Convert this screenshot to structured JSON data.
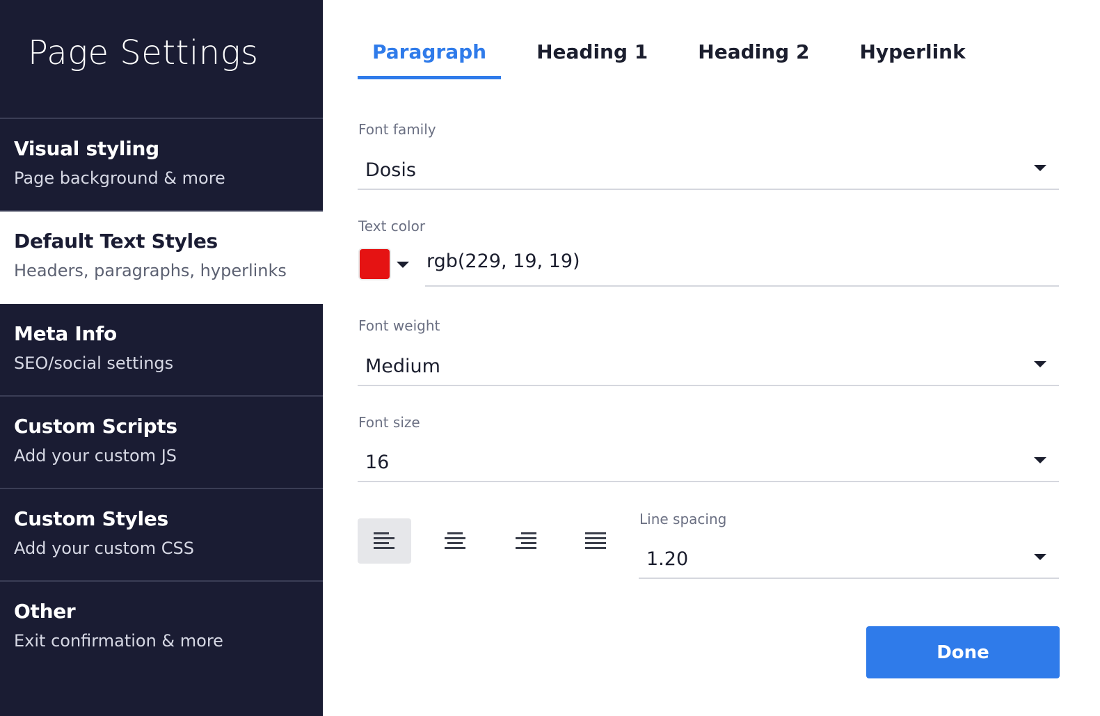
{
  "sidebar": {
    "title": "Page Settings",
    "items": [
      {
        "label": "Visual styling",
        "sub": "Page background & more"
      },
      {
        "label": "Default Text Styles",
        "sub": "Headers, paragraphs, hyperlinks"
      },
      {
        "label": "Meta Info",
        "sub": "SEO/social settings"
      },
      {
        "label": "Custom Scripts",
        "sub": "Add your custom JS"
      },
      {
        "label": "Custom Styles",
        "sub": "Add your custom CSS"
      },
      {
        "label": "Other",
        "sub": "Exit confirmation & more"
      }
    ],
    "active_index": 1
  },
  "tabs": [
    {
      "label": "Paragraph",
      "active": true
    },
    {
      "label": "Heading 1",
      "active": false
    },
    {
      "label": "Heading 2",
      "active": false
    },
    {
      "label": "Hyperlink",
      "active": false
    }
  ],
  "form": {
    "font_family": {
      "label": "Font family",
      "value": "Dosis"
    },
    "text_color": {
      "label": "Text color",
      "value": "rgb(229, 19, 19)",
      "swatch": "#e51313"
    },
    "font_weight": {
      "label": "Font weight",
      "value": "Medium"
    },
    "font_size": {
      "label": "Font size",
      "value": "16"
    },
    "alignment": {
      "options": [
        "left",
        "center",
        "right",
        "justify"
      ],
      "selected": "left"
    },
    "line_spacing": {
      "label": "Line spacing",
      "value": "1.20"
    }
  },
  "done_label": "Done",
  "colors": {
    "sidebar_bg": "#1a1c33",
    "accent": "#2f7bea"
  }
}
